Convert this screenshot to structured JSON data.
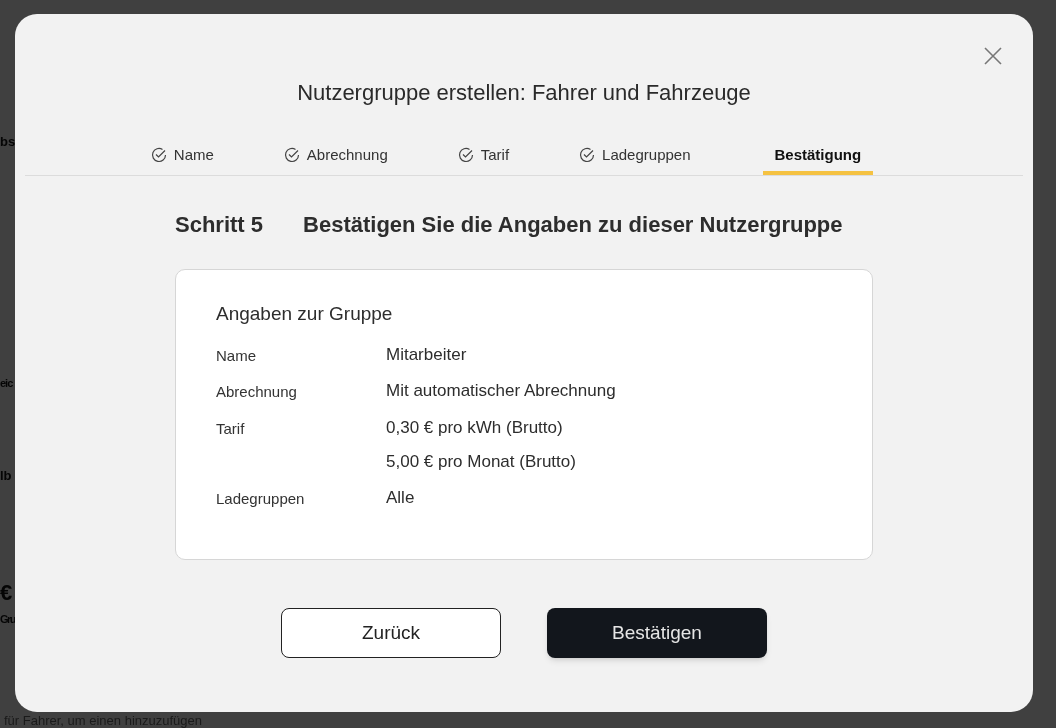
{
  "background": {
    "fragments": [
      "bs",
      "eic",
      "lb",
      "€",
      "Gru"
    ],
    "hint": "für Fahrer, um einen hinzuzufügen"
  },
  "dialog": {
    "title": "Nutzergruppe erstellen: Fahrer und Fahrzeuge",
    "steps": [
      {
        "label": "Name",
        "done": true,
        "selected": false
      },
      {
        "label": "Abrechnung",
        "done": true,
        "selected": false
      },
      {
        "label": "Tarif",
        "done": true,
        "selected": false
      },
      {
        "label": "Ladegruppen",
        "done": true,
        "selected": false
      },
      {
        "label": "Bestätigung",
        "done": false,
        "selected": true
      }
    ],
    "step_number": "Schritt 5",
    "step_heading": "Bestätigen Sie die Angaben zu dieser Nutzergruppe",
    "card": {
      "title": "Angaben zur Gruppe",
      "rows": [
        {
          "label": "Name",
          "values": [
            "Mitarbeiter"
          ]
        },
        {
          "label": "Abrechnung",
          "values": [
            "Mit automatischer Abrechnung"
          ]
        },
        {
          "label": "Tarif",
          "values": [
            "0,30 € pro kWh (Brutto)",
            "5,00 € pro Monat (Brutto)"
          ]
        },
        {
          "label": "Ladegruppen",
          "values": [
            "Alle"
          ]
        }
      ]
    },
    "buttons": [
      {
        "label": "Zurück",
        "kind": "secondary"
      },
      {
        "label": "Bestätigen",
        "kind": "primary"
      }
    ]
  }
}
